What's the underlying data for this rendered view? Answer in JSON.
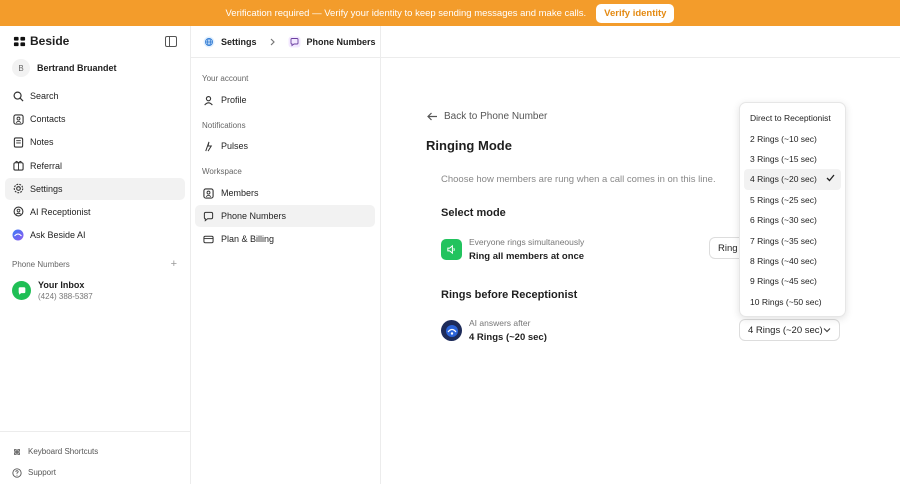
{
  "banner": {
    "message": "Verification required — Verify your identity to keep sending messages and make calls.",
    "button": "Verify identity",
    "color": "#f39c2b"
  },
  "sidebar": {
    "brand": "Beside",
    "user_initial": "B",
    "user_name": "Bertrand Bruandet",
    "items": [
      {
        "label": "Search",
        "icon": "search-icon"
      },
      {
        "label": "Contacts",
        "icon": "contacts-icon"
      },
      {
        "label": "Notes",
        "icon": "notes-icon"
      },
      {
        "label": "Referral",
        "icon": "referral-icon"
      },
      {
        "label": "Settings",
        "icon": "gear-icon"
      },
      {
        "label": "AI Receptionist",
        "icon": "receptionist-icon"
      },
      {
        "label": "Ask Beside AI",
        "icon": "beside-ai-icon"
      }
    ],
    "phone_numbers_heading": "Phone Numbers",
    "add": "+",
    "inbox": {
      "title": "Your Inbox",
      "number": "(424) 388-5387"
    },
    "bottom": [
      {
        "label": "Keyboard Shortcuts",
        "icon": "keyboard-icon"
      },
      {
        "label": "Support",
        "icon": "help-icon"
      }
    ]
  },
  "breadcrumb": {
    "settings": "Settings",
    "phone_numbers": "Phone Numbers"
  },
  "settings_nav": {
    "account_heading": "Your account",
    "profile": "Profile",
    "notifications_heading": "Notifications",
    "pulses": "Pulses",
    "workspace_heading": "Workspace",
    "members": "Members",
    "phone_numbers": "Phone Numbers",
    "plan_billing": "Plan & Billing"
  },
  "main": {
    "back": "Back to Phone Number",
    "title": "Ringing Mode",
    "description": "Choose how members are rung when a call comes in on this line.",
    "select_mode_heading": "Select mode",
    "mode_line1": "Everyone rings simultaneously",
    "mode_line2": "Ring all members at once",
    "mode_button": "Ring a",
    "rings_heading": "Rings before Receptionist",
    "ai_line1": "AI answers after",
    "ai_line2": "4 Rings (~20 sec)",
    "select_value": "4 Rings (~20 sec)"
  },
  "dropdown": {
    "selected_index": 3,
    "options": [
      "Direct to Receptionist",
      "2 Rings (~10 sec)",
      "3 Rings (~15 sec)",
      "4 Rings (~20 sec)",
      "5 Rings (~25 sec)",
      "6 Rings (~30 sec)",
      "7 Rings (~35 sec)",
      "8 Rings (~40 sec)",
      "9 Rings (~45 sec)",
      "10 Rings (~50 sec)"
    ]
  }
}
